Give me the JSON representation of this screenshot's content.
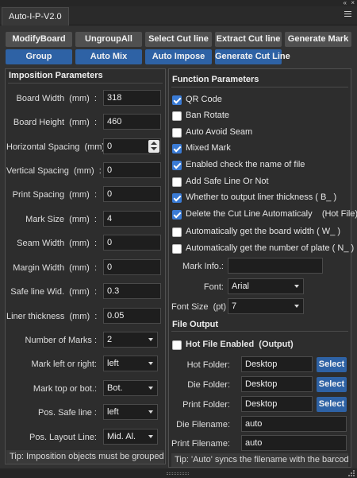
{
  "panel": {
    "tab_title": "Auto-I-P-V2.0",
    "collapse_glyph": "«",
    "close_glyph": "×"
  },
  "toolbar": {
    "row1": [
      "ModifyBoard",
      "UngroupAll",
      "Select Cut line",
      "Extract Cut line",
      "Generate Mark"
    ],
    "row2": [
      "Group",
      "Auto Mix",
      "Auto Impose",
      "Generate Cut Line"
    ]
  },
  "imposition": {
    "title": "Imposition Parameters",
    "fields": [
      {
        "label": "Board Width  (mm)  :",
        "value": "318"
      },
      {
        "label": "Board Height  (mm)  :",
        "value": "460"
      },
      {
        "label": "Horizontal Spacing  (mm)  :",
        "value": "0"
      },
      {
        "label": "Vertical Spacing  (mm)  :",
        "value": "0"
      },
      {
        "label": "Print Spacing  (mm)  :",
        "value": "0"
      },
      {
        "label": "Mark Size  (mm)  :",
        "value": "4"
      },
      {
        "label": "Seam Width  (mm)  :",
        "value": "0"
      },
      {
        "label": "Margin Width  (mm)  :",
        "value": "0"
      },
      {
        "label": "Safe line Wid.  (mm)  :",
        "value": "0.3"
      },
      {
        "label": "Liner thickness  (mm)  :",
        "value": "0.05"
      }
    ],
    "selects": [
      {
        "label": "Number of Marks :",
        "value": "2"
      },
      {
        "label": "Mark left or right:",
        "value": "left"
      },
      {
        "label": "Mark top or bot.:",
        "value": "Bot."
      },
      {
        "label": "Pos. Safe line :",
        "value": "left"
      },
      {
        "label": "Pos. Layout Line:",
        "value": "Mid. Al."
      }
    ],
    "tip": "Tip: Imposition objects must be grouped!"
  },
  "function": {
    "title": "Function Parameters",
    "checkboxes": [
      {
        "label": "QR Code",
        "checked": true
      },
      {
        "label": "Ban Rotate",
        "checked": false
      },
      {
        "label": "Auto Avoid Seam",
        "checked": false
      },
      {
        "label": "Mixed Mark",
        "checked": true
      },
      {
        "label": "Enabled check the name of file",
        "checked": true
      },
      {
        "label": "Add Safe Line Or Not",
        "checked": false
      },
      {
        "label": "Whether to output liner thickness ( B_ )",
        "checked": true
      },
      {
        "label": "Delete the Cut Line Automaticaly    (Hot File)",
        "checked": true
      },
      {
        "label": "Automatically get the board width ( W_ )",
        "checked": false
      },
      {
        "label": "Automatically get the number of plate ( N_ )",
        "checked": false
      }
    ],
    "mark_info_label": "Mark Info.:",
    "mark_info_value": "",
    "font_label": "Font:",
    "font_value": "Arial",
    "font_size_label": "Font Size  (pt)  :",
    "font_size_value": "7"
  },
  "file_output": {
    "title": "File Output",
    "hot_file_label": "Hot File Enabled  (Output)",
    "hot_file_checked": false,
    "folders": [
      {
        "label": "Hot Folder:",
        "value": "Desktop",
        "button": "Select"
      },
      {
        "label": "Die Folder:",
        "value": "Desktop",
        "button": "Select"
      },
      {
        "label": "Print Folder:",
        "value": "Desktop",
        "button": "Select"
      }
    ],
    "die_filename_label": "Die Filename:",
    "die_filename_value": "auto",
    "print_filename_label": "Print Filename:",
    "print_filename_value": "auto",
    "tip": "Tip: 'Auto' syncs the filename with the barcode"
  }
}
